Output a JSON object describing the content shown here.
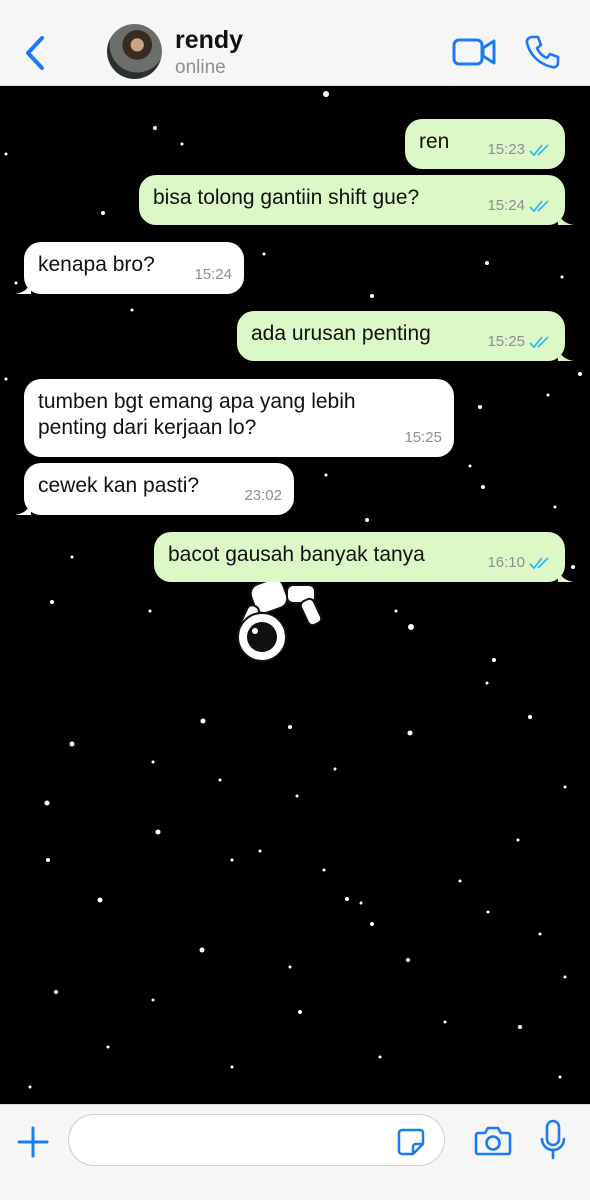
{
  "header": {
    "contact_name": "rendy",
    "contact_status": "online",
    "icons": [
      "chevron-left-icon",
      "avatar",
      "video-camera-icon",
      "phone-icon"
    ]
  },
  "messages": [
    {
      "direction": "out",
      "text": "ren",
      "time": "15:23",
      "read": true
    },
    {
      "direction": "out",
      "text": "bisa tolong gantiin shift gue?",
      "time": "15:24",
      "read": true
    },
    {
      "direction": "in",
      "text": "kenapa bro?",
      "time": "15:24"
    },
    {
      "direction": "out",
      "text": "ada urusan penting",
      "time": "15:25",
      "read": true
    },
    {
      "direction": "in",
      "text": "tumben bgt emang apa yang lebih\npenting dari kerjaan lo?",
      "time": "15:25"
    },
    {
      "direction": "in",
      "text": "cewek kan pasti?",
      "time": "23:02"
    },
    {
      "direction": "out",
      "text": "bacot gausah banyak tanya",
      "time": "16:10",
      "read": true
    }
  ],
  "input": {
    "value": "",
    "placeholder": ""
  },
  "colors": {
    "accent": "#1a7cf0",
    "outgoing_bubble": "#dcf8c6",
    "incoming_bubble": "#ffffff",
    "read_ticks": "#34b7f1",
    "chat_background": "#000000"
  }
}
